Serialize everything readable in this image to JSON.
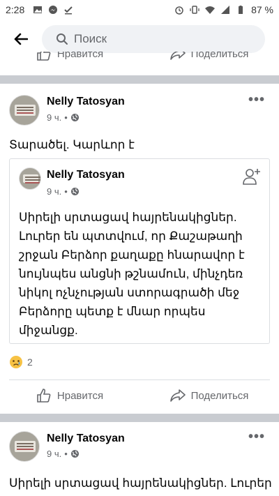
{
  "status_bar": {
    "time": "2:28",
    "battery": "87 %"
  },
  "search": {
    "placeholder": "Поиск"
  },
  "partial_actions": {
    "like": "Нравится",
    "share": "Поделиться"
  },
  "post1": {
    "author": "Nelly Tatosyan",
    "time": "9 ч.",
    "text": "Տարածել. Կարևոր է",
    "shared": {
      "author": "Nelly Tatosyan",
      "time": "9 ч.",
      "lines": [
        "Սիրելի սրտացավ հայրենակիցներ.",
        "Լուրեր են պտտվում, որ Քաշաթաղի",
        "շրջան Բերձոր քաղաքը հնարավոր է",
        "նույնպես անցնի թշնամուն, մինչդեռ",
        "նիկոլ ոչնչության ստորագրածի մեջ",
        "Բերձորը պետք է մնար որպես",
        "միջանցք."
      ]
    },
    "reaction_count": "2",
    "like_label": "Нравится",
    "share_label": "Поделиться"
  },
  "post2": {
    "author": "Nelly Tatosyan",
    "time": "9 ч.",
    "text": "Սիրելի սրտացավ հայրենակիցներ. Լուրեր"
  }
}
